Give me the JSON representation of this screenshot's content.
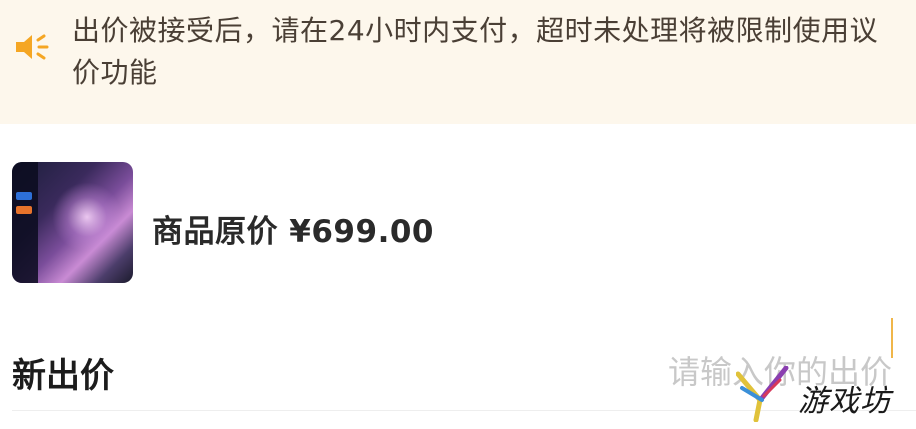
{
  "notice": {
    "icon": "speaker-icon",
    "icon_color": "#f5a623",
    "background": "#fdf7ec",
    "text": "出价被接受后，请在24小时内支付，超时未处理将被限制使用议价功能"
  },
  "product": {
    "thumbnail": "game-artwork-thumbnail",
    "original_price_label": "商品原价 ¥699.00"
  },
  "bid": {
    "label": "新出价",
    "input_value": "",
    "input_placeholder": "请输入你的出价"
  },
  "watermark": {
    "text": "游戏坊",
    "logo": "y-logo-icon"
  }
}
